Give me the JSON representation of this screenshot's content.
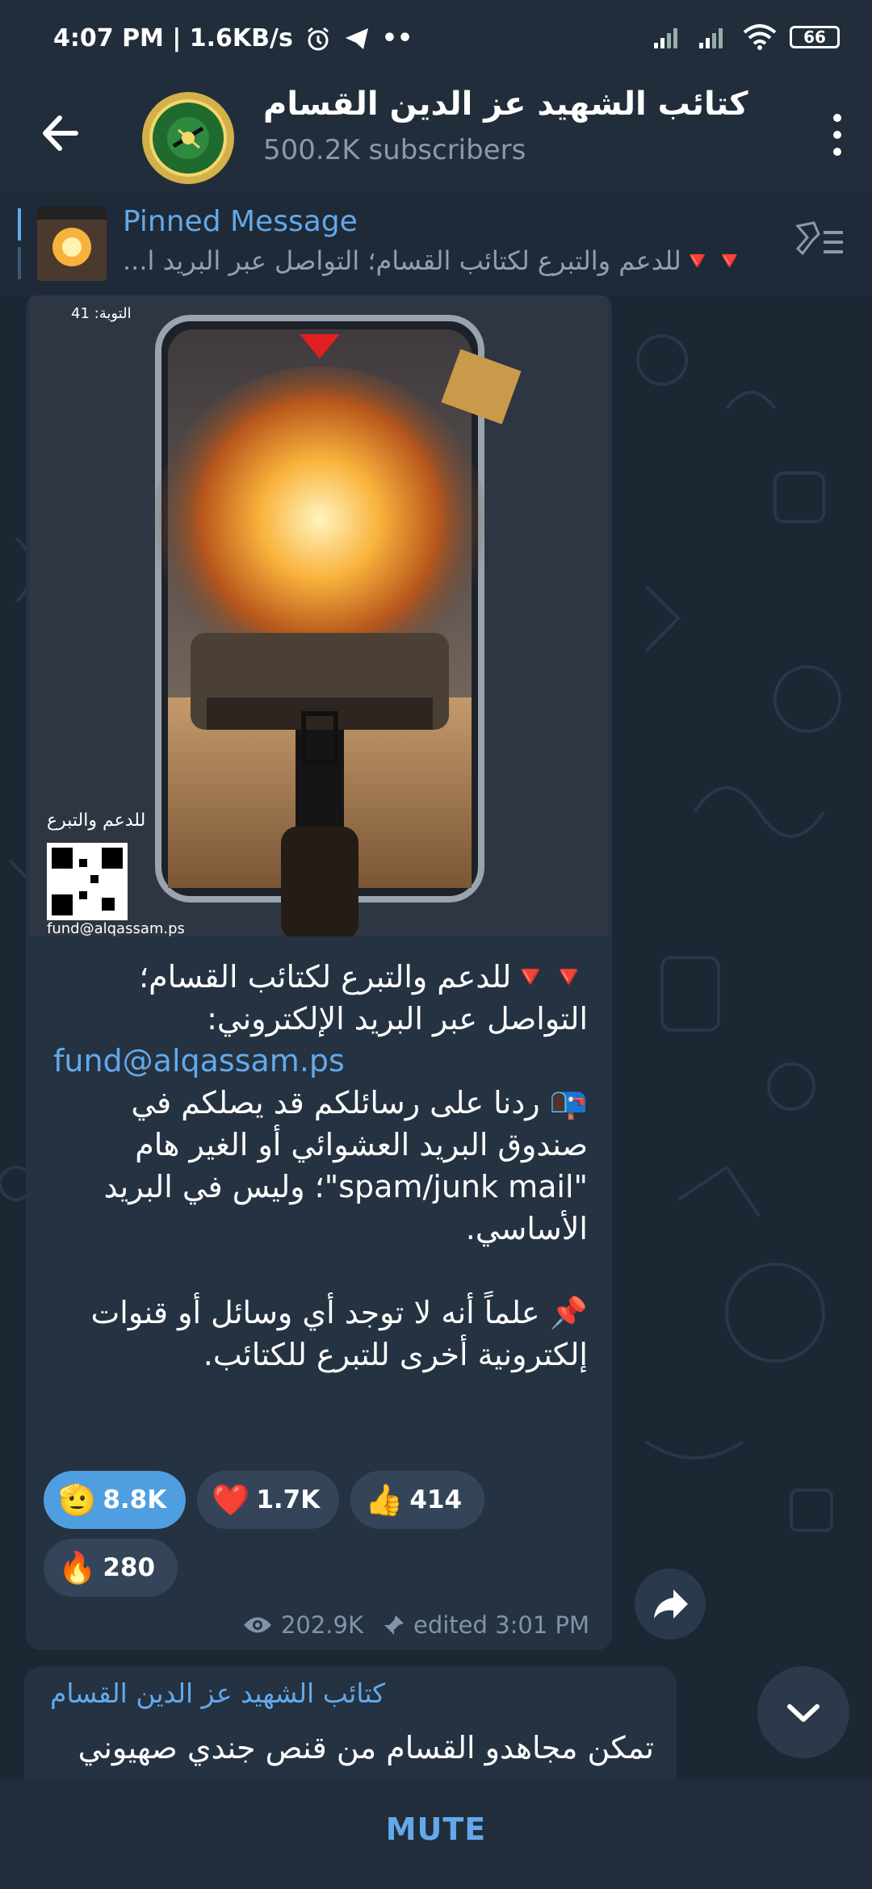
{
  "status_bar": {
    "time_speed": "4:07 PM | 1.6KB/s",
    "extra_dots": "••",
    "battery": "66"
  },
  "header": {
    "title": "كتائب الشهيد عز الدين القسام",
    "subtitle": "500.2K subscribers"
  },
  "pinned": {
    "title": "Pinned Message",
    "text": "🔻🔻للدعم والتبرع لكتائب القسام؛ التواصل عبر البريد ا..."
  },
  "post": {
    "image_overlay": {
      "caption": "للدعم والتبرع",
      "counter": "التوبة: 41",
      "email": "fund@alqassam.ps"
    },
    "para1_line1": "🔻🔻للدعم والتبرع لكتائب القسام؛",
    "para1_line2": "التواصل عبر البريد الإلكتروني:",
    "email": "fund@alqassam.ps",
    "para2": "📭 ردنا على رسائلكم قد يصلكم في صندوق البريد العشوائي أو الغير هام \"spam/junk mail\"؛ وليس في البريد الأساسي.",
    "para3": "📌 علماً أنه لا توجد أي وسائل أو قنوات إلكترونية أخرى للتبرع للكتائب.",
    "reactions": [
      {
        "emoji": "🫡",
        "count": "8.8K",
        "active": true
      },
      {
        "emoji": "❤️",
        "count": "1.7K",
        "active": false
      },
      {
        "emoji": "👍",
        "count": "414",
        "active": false
      },
      {
        "emoji": "🔥",
        "count": "280",
        "active": false
      }
    ],
    "views": "202.9K",
    "edited": "edited 3:01 PM"
  },
  "next_message": {
    "author": "كتائب الشهيد عز الدين القسام",
    "text": "تمكن مجاهدو القسام من قنص جندي صهيوني"
  },
  "bottom": {
    "mute_label": "MUTE"
  },
  "colors": {
    "accent": "#63a9ea",
    "bubble": "#253241",
    "background": "#1b2733",
    "header": "#212d3b"
  }
}
